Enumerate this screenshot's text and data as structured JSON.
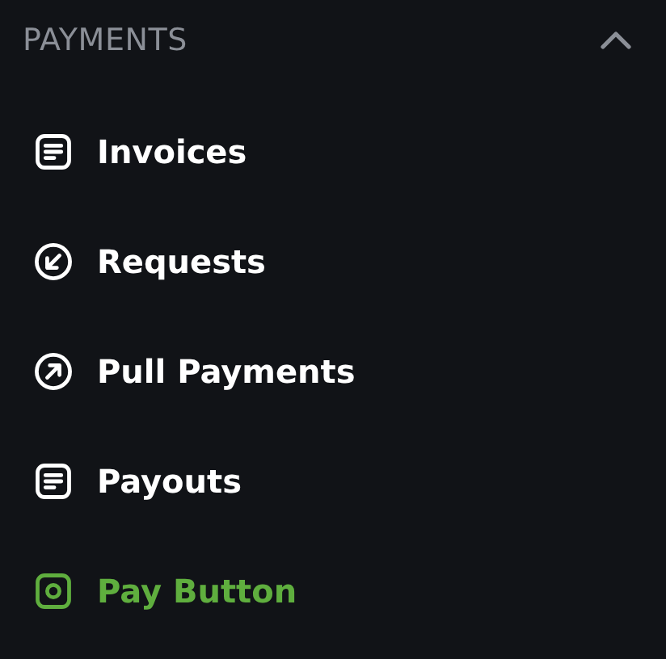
{
  "section": {
    "title": "PAYMENTS",
    "expanded": true
  },
  "items": [
    {
      "label": "Invoices",
      "kind": "document",
      "selected": false
    },
    {
      "label": "Requests",
      "kind": "incoming",
      "selected": false
    },
    {
      "label": "Pull Payments",
      "kind": "outgoing",
      "selected": false
    },
    {
      "label": "Payouts",
      "kind": "document",
      "selected": false
    },
    {
      "label": "Pay Button",
      "kind": "button",
      "selected": true
    }
  ]
}
